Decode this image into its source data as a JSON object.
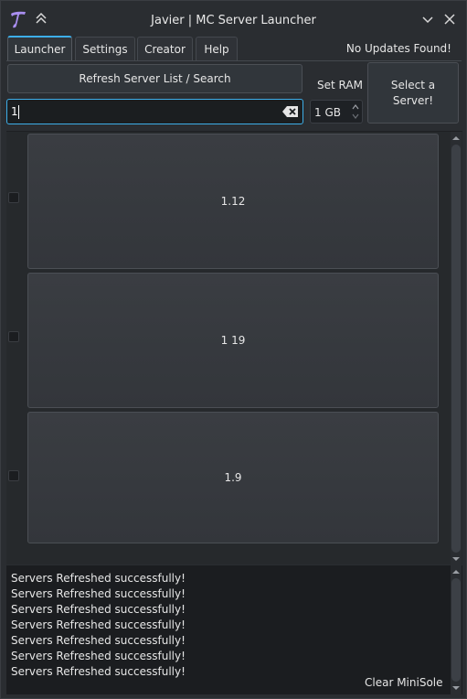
{
  "window": {
    "title": "Javier | MC Server Launcher"
  },
  "tabs": [
    {
      "label": "Launcher",
      "active": true
    },
    {
      "label": "Settings",
      "active": false
    },
    {
      "label": "Creator",
      "active": false
    },
    {
      "label": "Help",
      "active": false
    }
  ],
  "status": {
    "updates": "No Updates Found!"
  },
  "toolbar": {
    "refresh_label": "Refresh Server List / Search",
    "ram_label": "Set RAM",
    "ram_value": "1 GB",
    "select_label_line1": "Select a",
    "select_label_line2": "Server!"
  },
  "search": {
    "value": "1"
  },
  "servers": [
    {
      "label": "1.12"
    },
    {
      "label": "1 19"
    },
    {
      "label": "1.9"
    }
  ],
  "console": {
    "lines": [
      "Servers Refreshed successfully!",
      "Servers Refreshed successfully!",
      "Servers Refreshed successfully!",
      "Servers Refreshed successfully!",
      "Servers Refreshed successfully!",
      "Servers Refreshed successfully!",
      "Servers Refreshed successfully!"
    ],
    "clear_label": "Clear MiniSole"
  },
  "colors": {
    "accent": "#3daee9",
    "logo": "#a98ef0"
  }
}
